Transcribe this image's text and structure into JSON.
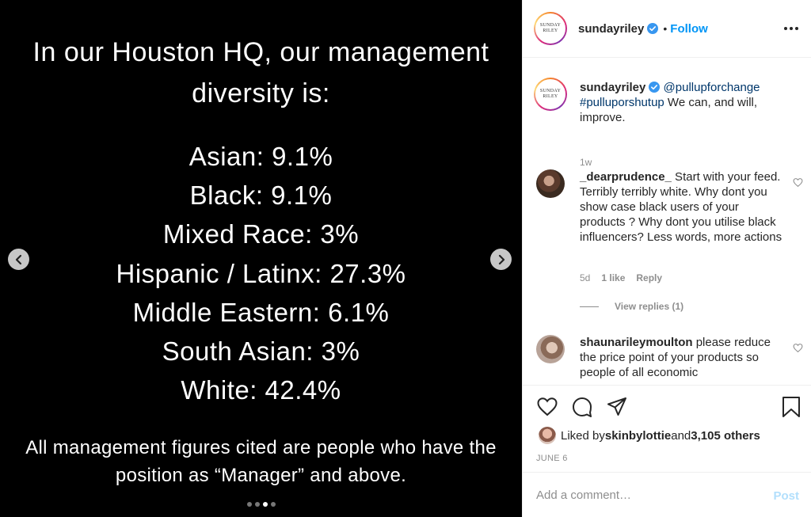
{
  "slide": {
    "title": "In our Houston HQ, our management diversity is:",
    "stats": [
      "Asian: 9.1%",
      "Black: 9.1%",
      "Mixed Race: 3%",
      "Hispanic / Latinx: 27.3%",
      "Middle Eastern: 6.1%",
      "South Asian: 3%",
      "White: 42.4%"
    ],
    "footnote": "All management figures cited are people who have the position as “Manager” and above.",
    "total_slides": 4,
    "active_slide": 3
  },
  "header": {
    "avatar_text": "SUNDAY RILEY",
    "username": "sundayriley",
    "bullet": "•",
    "follow_label": "Follow",
    "more_icon": "more-horizontal-icon"
  },
  "caption": {
    "username": "sundayriley",
    "mention": "@pullupforchange",
    "hashtag": "#pulluporshutup",
    "text": " We can, and will, improve.",
    "time": "1w"
  },
  "comments": [
    {
      "username": "_dearprudence_",
      "text": " Start with your feed. Terribly terribly white. Why dont you show case black users of your products ? Why dont you utilise black influencers? Less words, more actions",
      "time": "5d",
      "likes": "1 like",
      "reply_label": "Reply",
      "view_replies": "View replies (1)"
    },
    {
      "username": "shaunarileymoulton",
      "text": " please reduce the price point of your products so people of all economic"
    }
  ],
  "likes": {
    "prefix": "Liked by ",
    "user": "skinbylottie",
    "middle": " and ",
    "count": "3,105 others"
  },
  "post_date": "JUNE 6",
  "add_comment": {
    "placeholder": "Add a comment…",
    "post_label": "Post"
  },
  "colors": {
    "accent": "#0095f6",
    "link": "#00376b",
    "muted": "#8e8e8e",
    "post_disabled": "#b2dffc"
  }
}
